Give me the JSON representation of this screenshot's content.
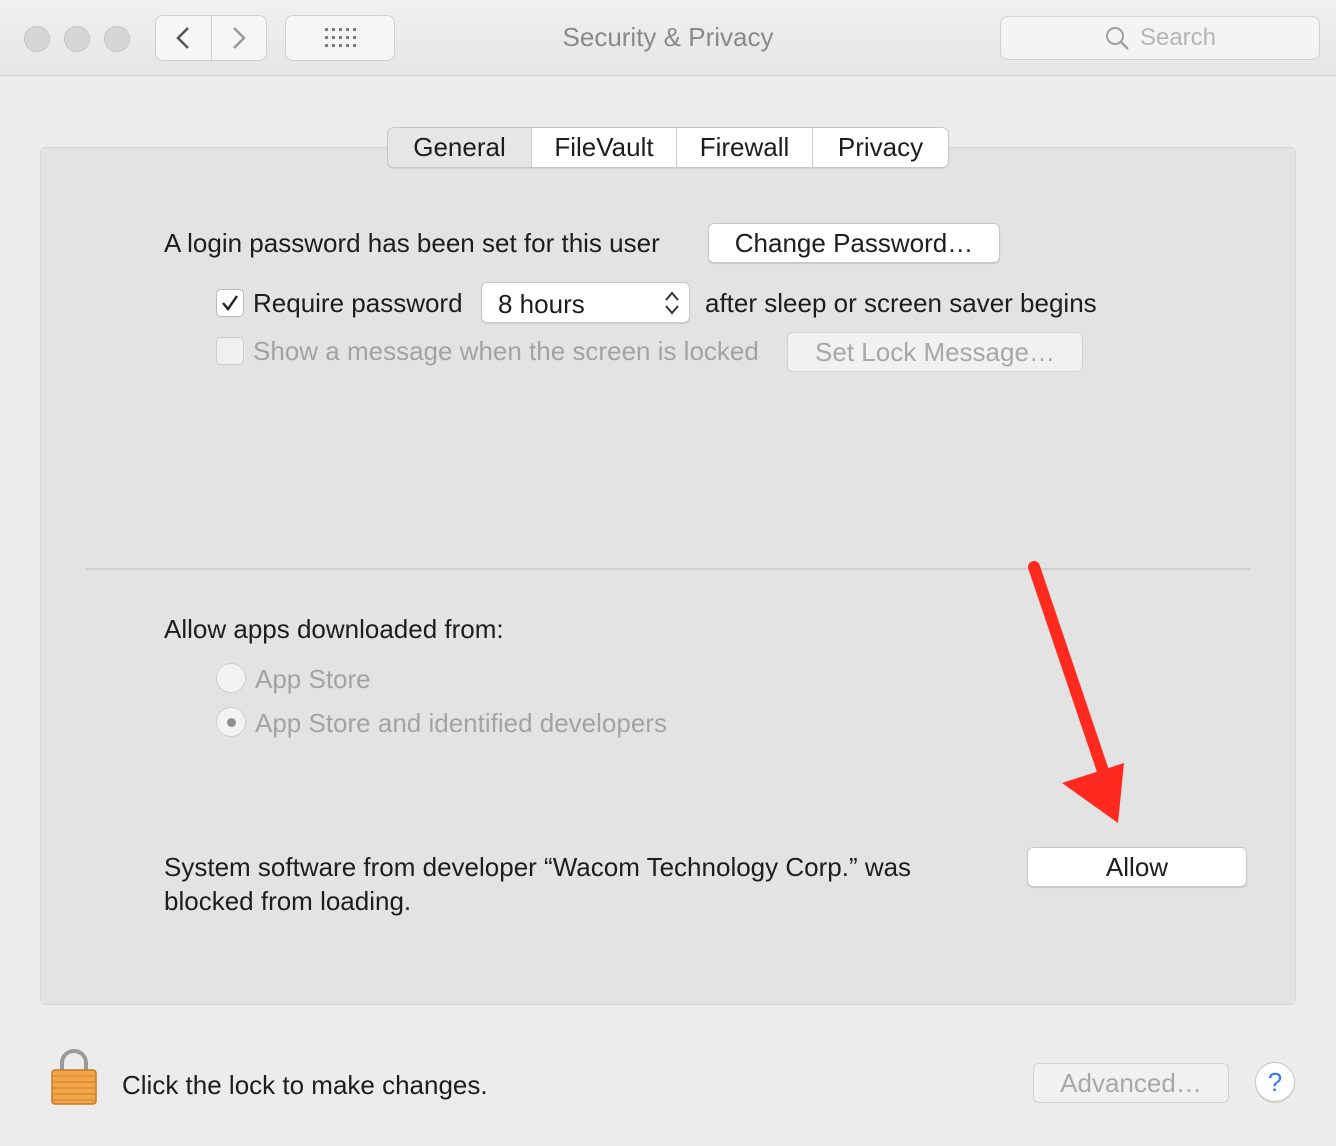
{
  "window": {
    "title": "Security & Privacy",
    "search_placeholder": "Search"
  },
  "tabs": [
    {
      "label": "General",
      "active": true
    },
    {
      "label": "FileVault",
      "active": false
    },
    {
      "label": "Firewall",
      "active": false
    },
    {
      "label": "Privacy",
      "active": false
    }
  ],
  "general": {
    "login_password_text": "A login password has been set for this user",
    "change_password_label": "Change Password…",
    "require_password_label": "Require password",
    "require_password_checked": true,
    "require_password_delay": "8 hours",
    "after_sleep_text": "after sleep or screen saver begins",
    "show_message_label": "Show a message when the screen is locked",
    "show_message_checked": false,
    "set_lock_message_label": "Set Lock Message…",
    "allow_apps_label": "Allow apps downloaded from:",
    "radio_app_store": "App Store",
    "radio_identified": "App Store and identified developers",
    "selected_option": "App Store and identified developers",
    "blocked_line1": "System software from developer “Wacom Technology Corp.” was",
    "blocked_line2": "blocked from loading.",
    "allow_label": "Allow"
  },
  "footer": {
    "lock_text": "Click the lock to make changes.",
    "advanced_label": "Advanced…",
    "help_label": "?"
  },
  "colors": {
    "annotation_arrow": "#ff2a1f",
    "accent_blue": "#3478f6"
  }
}
